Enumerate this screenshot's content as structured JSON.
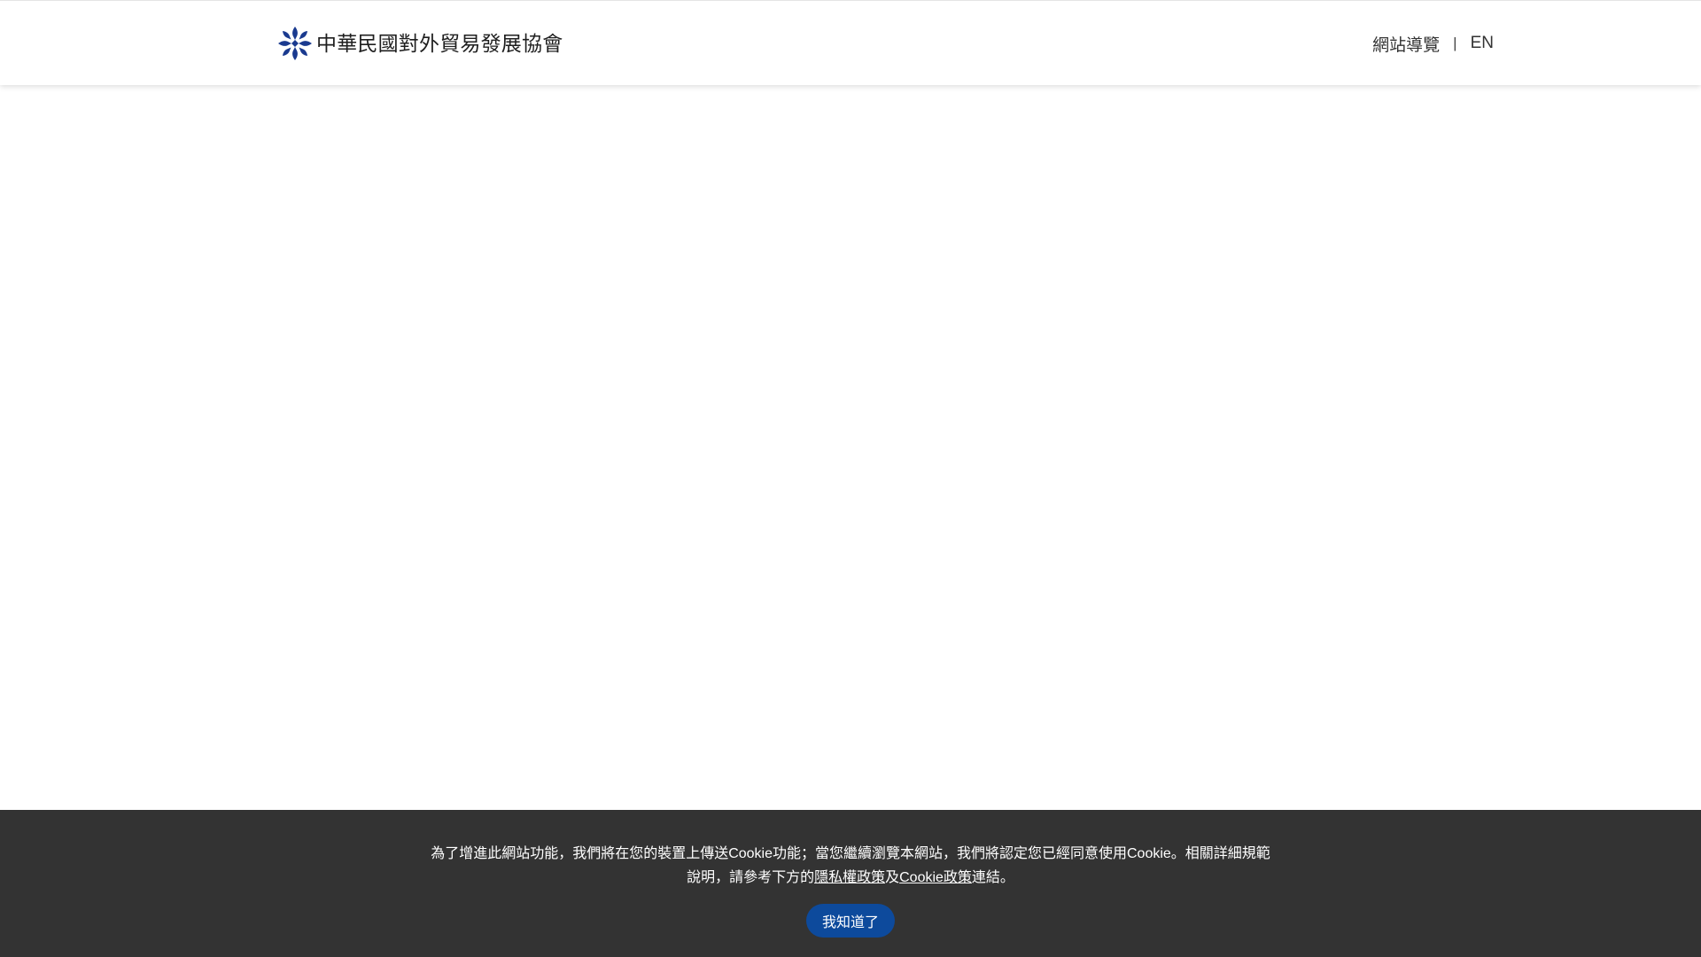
{
  "header": {
    "logo_text": "中華民國對外貿易發展協會",
    "nav": {
      "sitemap_label": "網站導覽",
      "separator": "|",
      "language_label": "EN"
    }
  },
  "cookie_notice": {
    "text_before": "為了增進此網站功能，我們將在您的裝置上傳送Cookie功能；當您繼續瀏覽本網站，我們將認定您已經同意使用Cookie。相關詳細規範說明，請參考下方的",
    "privacy_link": "隱私權政策",
    "connector": "及",
    "cookie_link": "Cookie政策",
    "text_after": "連結。",
    "accept_button": "我知道了"
  },
  "colors": {
    "brand_blue": "#0d4a9c",
    "logo_blue": "#1a3a8f",
    "cookie_bar_bg": "#333333",
    "header_bg": "#ffffff"
  },
  "icons": {
    "logo": "taitra-logo-icon"
  }
}
